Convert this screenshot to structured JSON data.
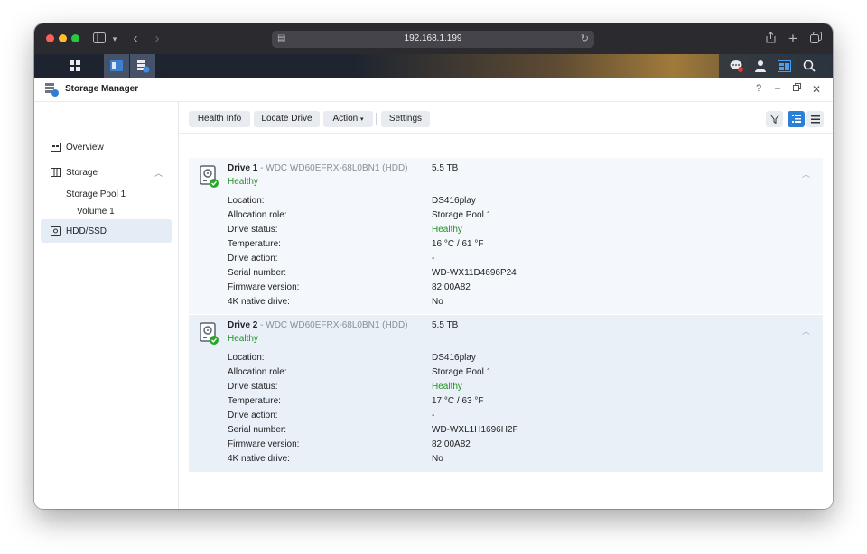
{
  "browser": {
    "url": "192.168.1.199"
  },
  "app": {
    "title": "Storage Manager"
  },
  "sidebar": {
    "items": [
      {
        "label": "Overview",
        "icon": "overview-icon"
      },
      {
        "label": "Storage",
        "icon": "storage-icon"
      },
      {
        "label": "Storage Pool 1"
      },
      {
        "label": "Volume 1"
      },
      {
        "label": "HDD/SSD",
        "icon": "hdd-icon",
        "selected": true
      }
    ]
  },
  "toolbar": {
    "health_info": "Health Info",
    "locate_drive": "Locate Drive",
    "action": "Action",
    "settings": "Settings"
  },
  "field_labels": [
    "Location:",
    "Allocation role:",
    "Drive status:",
    "Temperature:",
    "Drive action:",
    "Serial number:",
    "Firmware version:",
    "4K native drive:"
  ],
  "drives": [
    {
      "name": "Drive 1",
      "model": "- WDC WD60EFRX-68L0BN1 (HDD)",
      "capacity": "5.5 TB",
      "health": "Healthy",
      "values": [
        "DS416play",
        "Storage Pool 1",
        "Healthy",
        "16 °C / 61 °F",
        "-",
        "WD-WX11D4696P24",
        "82.00A82",
        "No"
      ]
    },
    {
      "name": "Drive 2",
      "model": "- WDC WD60EFRX-68L0BN1 (HDD)",
      "capacity": "5.5 TB",
      "health": "Healthy",
      "values": [
        "DS416play",
        "Storage Pool 1",
        "Healthy",
        "17 °C / 63 °F",
        "-",
        "WD-WXL1H1696H2F",
        "82.00A82",
        "No"
      ]
    }
  ],
  "colors": {
    "accent": "#2b7fd6",
    "healthy": "#239123",
    "selected_bg": "#e4ecf6"
  }
}
